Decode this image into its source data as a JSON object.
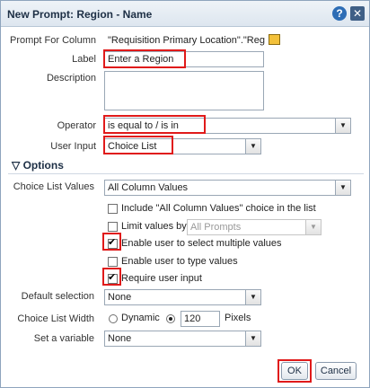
{
  "dialog": {
    "title": "New Prompt: Region - Name",
    "help_icon": "question-mark-icon",
    "close_icon": "close-x-icon"
  },
  "fields": {
    "prompt_for_column_label": "Prompt For Column",
    "prompt_for_column_value": "\"Requisition Primary Location\".\"Reg",
    "label_label": "Label",
    "label_value": "Enter a Region",
    "description_label": "Description",
    "description_value": "",
    "operator_label": "Operator",
    "operator_value": "is equal to / is in",
    "user_input_label": "User Input",
    "user_input_value": "Choice List"
  },
  "options": {
    "header": "Options",
    "choice_list_values_label": "Choice List Values",
    "choice_list_values_value": "All Column Values",
    "include_all_values": {
      "label": "Include \"All Column Values\" choice in the list",
      "checked": false
    },
    "limit_values_by": {
      "label": "Limit values by",
      "checked": false,
      "select_value": "All Prompts"
    },
    "multiple_values": {
      "label": "Enable user to select multiple values",
      "checked": true
    },
    "type_values": {
      "label": "Enable user to type values",
      "checked": false
    },
    "require_input": {
      "label": "Require user input",
      "checked": true
    },
    "default_selection_label": "Default selection",
    "default_selection_value": "None",
    "choice_list_width_label": "Choice List Width",
    "dynamic_label": "Dynamic",
    "width_value": "120",
    "pixels_label": "Pixels",
    "set_variable_label": "Set a variable",
    "set_variable_value": "None"
  },
  "buttons": {
    "ok": "OK",
    "cancel": "Cancel"
  }
}
